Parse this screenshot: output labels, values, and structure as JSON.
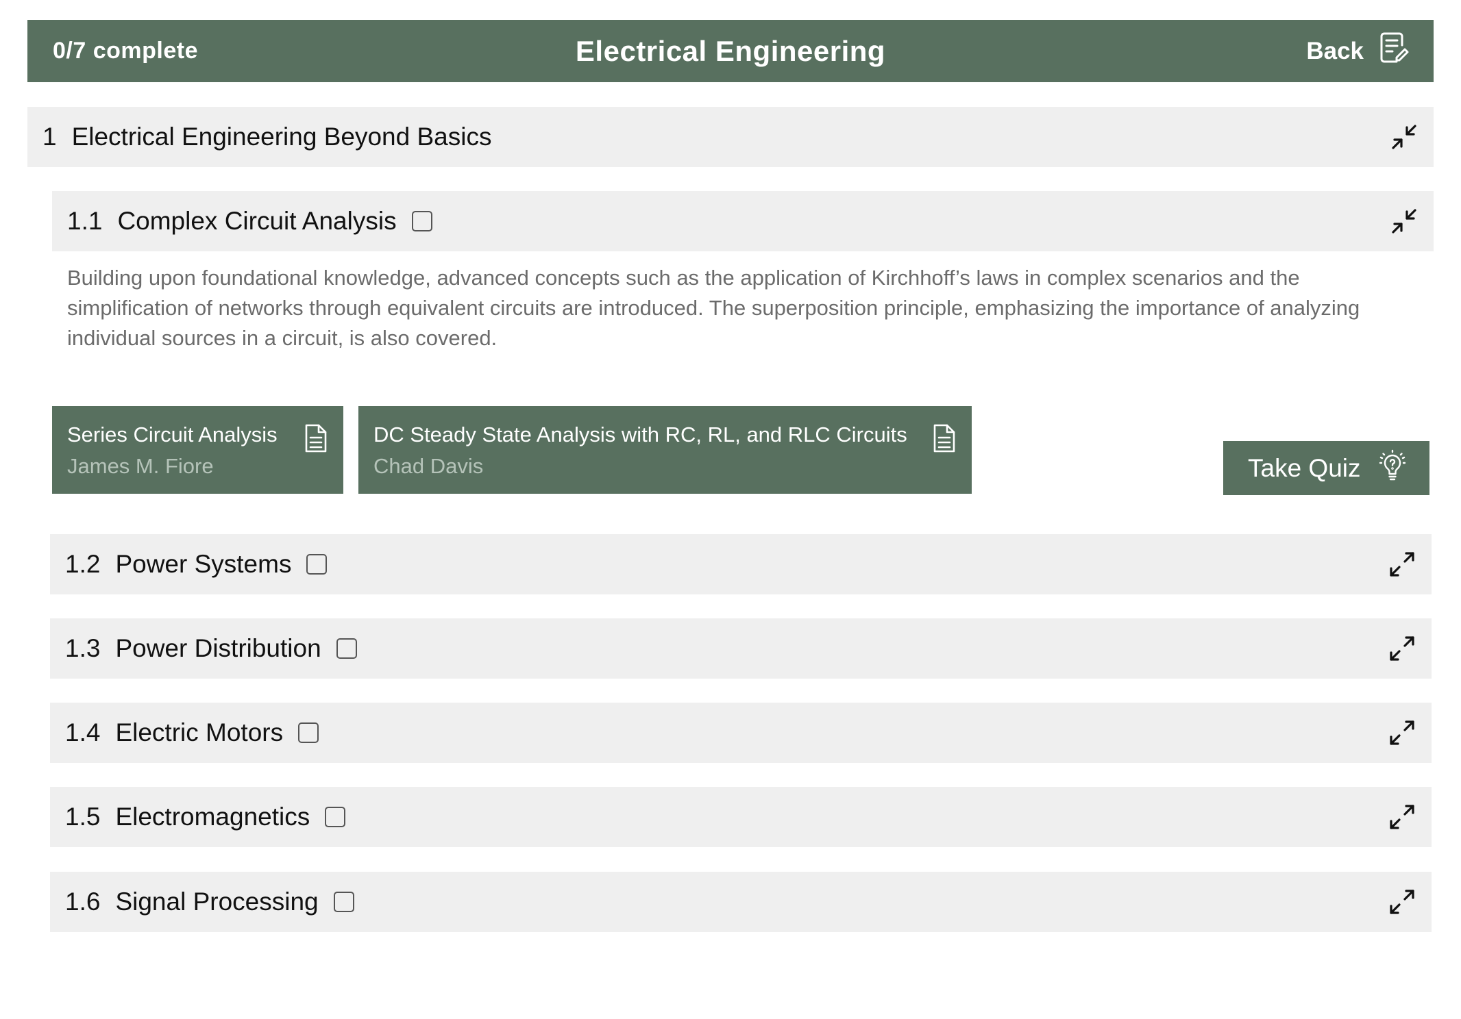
{
  "header": {
    "progress": "0/7 complete",
    "title": "Electrical Engineering",
    "back_label": "Back",
    "back_icon": "notes-edit-icon"
  },
  "section": {
    "number": "1",
    "title": "Electrical Engineering Beyond Basics",
    "icon": "collapse-icon"
  },
  "lessons": [
    {
      "number": "1.1",
      "title": "Complex Circuit Analysis",
      "checked": false,
      "expanded": true,
      "icon": "collapse-icon",
      "description": "Building upon foundational knowledge, advanced concepts such as the application of Kirchhoff’s laws in complex scenarios and the simplification of networks through equivalent circuits are introduced. The superposition principle, emphasizing the importance of analyzing individual sources in a circuit, is also covered.",
      "resources": [
        {
          "title": "Series Circuit Analysis",
          "author": "James M. Fiore",
          "icon": "document-icon"
        },
        {
          "title": "DC Steady State Analysis with RC, RL, and RLC Circuits",
          "author": "Chad Davis",
          "icon": "document-icon"
        }
      ],
      "quiz_label": "Take Quiz",
      "quiz_icon": "lightbulb-icon"
    },
    {
      "number": "1.2",
      "title": "Power Systems",
      "checked": false,
      "expanded": false,
      "icon": "expand-icon"
    },
    {
      "number": "1.3",
      "title": "Power Distribution",
      "checked": false,
      "expanded": false,
      "icon": "expand-icon"
    },
    {
      "number": "1.4",
      "title": "Electric Motors",
      "checked": false,
      "expanded": false,
      "icon": "expand-icon"
    },
    {
      "number": "1.5",
      "title": "Electromagnetics",
      "checked": false,
      "expanded": false,
      "icon": "expand-icon"
    },
    {
      "number": "1.6",
      "title": "Signal Processing",
      "checked": false,
      "expanded": false,
      "icon": "expand-icon"
    }
  ],
  "colors": {
    "header_bg": "#58705f",
    "row_bg": "#efefef",
    "description_text": "#6b6b6b",
    "resource_author": "#b5c3b9"
  }
}
